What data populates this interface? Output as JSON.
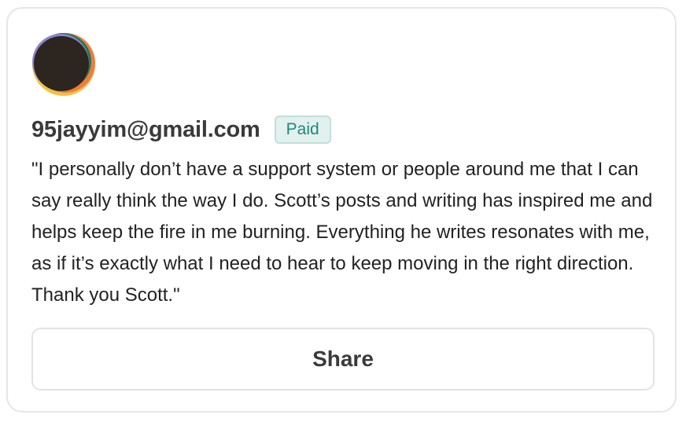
{
  "testimonial": {
    "avatar_icon": "user-avatar-icon",
    "email": "95jayyim@gmail.com",
    "badge": "Paid",
    "quote": "\"I personally don’t have a support system or people around me that I can say really think the way I do. Scott’s posts and writing has inspired me and helps keep the fire in me burning. Everything he writes resonates with me, as if it’s exactly what I need to hear to keep moving in the right direction. Thank you Scott.\"",
    "share_label": "Share"
  },
  "colors": {
    "badge_bg": "#e2f1ef",
    "badge_text": "#1e8a78",
    "avatar_dark": "#2c2520",
    "avatar_orange": "#f07c3a",
    "avatar_yellow": "#f5c043",
    "avatar_green": "#1f7a5c",
    "avatar_purple": "#8d84c9"
  }
}
